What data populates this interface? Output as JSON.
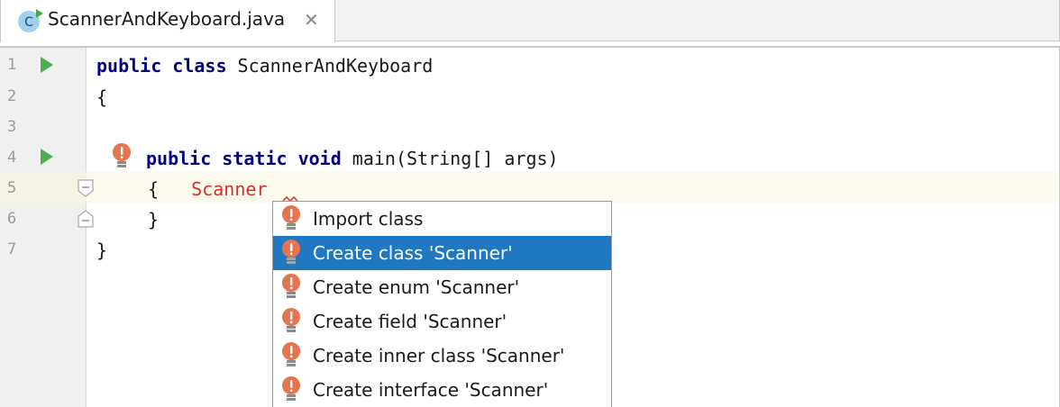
{
  "tab": {
    "title": "ScannerAndKeyboard.java",
    "icon": "java-class-icon",
    "icon_letter": "C",
    "close_glyph": "✕"
  },
  "gutter": {
    "line_numbers": [
      "1",
      "2",
      "3",
      "4",
      "5",
      "6",
      "7"
    ]
  },
  "code": {
    "line1": {
      "kw": "public class",
      "rest": " ScannerAndKeyboard"
    },
    "line2": "{",
    "line4": {
      "kw": "public static void",
      "rest": " main(String[] args)"
    },
    "line5": {
      "brace": "{   ",
      "error": "Scanner"
    },
    "line6": "}",
    "line7": "}"
  },
  "popup": {
    "items": [
      {
        "label": "Import class",
        "selected": false
      },
      {
        "label": "Create class 'Scanner'",
        "selected": true
      },
      {
        "label": "Create enum 'Scanner'",
        "selected": false
      },
      {
        "label": "Create field 'Scanner'",
        "selected": false
      },
      {
        "label": "Create inner class 'Scanner'",
        "selected": false
      },
      {
        "label": "Create interface 'Scanner'",
        "selected": false
      }
    ]
  },
  "colors": {
    "keyword": "#000080",
    "error": "#d0312d",
    "selection": "#1f78c1",
    "run_green": "#4caf50",
    "bulb_red": "#e8734f"
  }
}
